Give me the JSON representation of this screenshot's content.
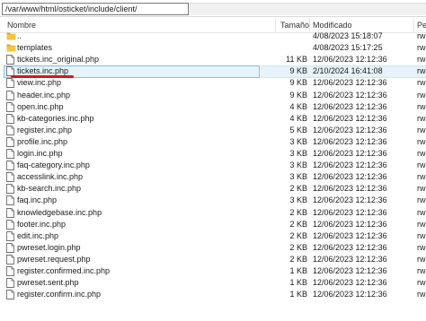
{
  "path": "/var/www/html/osticket/include/client/",
  "columns": {
    "name": "Nombre",
    "size": "Tamaño",
    "modified": "Modificado",
    "perm": "Pe"
  },
  "rows": [
    {
      "icon": "folder-icon",
      "name": "..",
      "size": "",
      "date": "4/08/2023 15:18:07",
      "perm": "rw"
    },
    {
      "icon": "folder-icon",
      "name": "templates",
      "size": "",
      "date": "4/08/2023 15:17:25",
      "perm": "rw"
    },
    {
      "icon": "file-icon",
      "name": "tickets.inc_original.php",
      "size": "11 KB",
      "date": "12/06/2023 12:12:36",
      "perm": "rw"
    },
    {
      "icon": "file-icon",
      "name": "tickets.inc.php",
      "size": "9 KB",
      "date": "2/10/2024 16:41:08",
      "perm": "rw"
    },
    {
      "icon": "file-icon",
      "name": "view.inc.php",
      "size": "9 KB",
      "date": "12/06/2023 12:12:36",
      "perm": "rw"
    },
    {
      "icon": "file-icon",
      "name": "header.inc.php",
      "size": "9 KB",
      "date": "12/06/2023 12:12:36",
      "perm": "rw"
    },
    {
      "icon": "file-icon",
      "name": "open.inc.php",
      "size": "4 KB",
      "date": "12/06/2023 12:12:36",
      "perm": "rw"
    },
    {
      "icon": "file-icon",
      "name": "kb-categories.inc.php",
      "size": "4 KB",
      "date": "12/06/2023 12:12:36",
      "perm": "rw"
    },
    {
      "icon": "file-icon",
      "name": "register.inc.php",
      "size": "5 KB",
      "date": "12/06/2023 12:12:36",
      "perm": "rw"
    },
    {
      "icon": "file-icon",
      "name": "profile.inc.php",
      "size": "3 KB",
      "date": "12/06/2023 12:12:36",
      "perm": "rw"
    },
    {
      "icon": "file-icon",
      "name": "login.inc.php",
      "size": "3 KB",
      "date": "12/06/2023 12:12:36",
      "perm": "rw"
    },
    {
      "icon": "file-icon",
      "name": "faq-category.inc.php",
      "size": "3 KB",
      "date": "12/06/2023 12:12:36",
      "perm": "rw"
    },
    {
      "icon": "file-icon",
      "name": "accesslink.inc.php",
      "size": "3 KB",
      "date": "12/06/2023 12:12:36",
      "perm": "rw"
    },
    {
      "icon": "file-icon",
      "name": "kb-search.inc.php",
      "size": "2 KB",
      "date": "12/06/2023 12:12:36",
      "perm": "rw"
    },
    {
      "icon": "file-icon",
      "name": "faq.inc.php",
      "size": "3 KB",
      "date": "12/06/2023 12:12:36",
      "perm": "rw"
    },
    {
      "icon": "file-icon",
      "name": "knowledgebase.inc.php",
      "size": "2 KB",
      "date": "12/06/2023 12:12:36",
      "perm": "rw"
    },
    {
      "icon": "file-icon",
      "name": "footer.inc.php",
      "size": "2 KB",
      "date": "12/06/2023 12:12:36",
      "perm": "rw"
    },
    {
      "icon": "file-icon",
      "name": "edit.inc.php",
      "size": "2 KB",
      "date": "12/06/2023 12:12:36",
      "perm": "rw"
    },
    {
      "icon": "file-icon",
      "name": "pwreset.login.php",
      "size": "2 KB",
      "date": "12/06/2023 12:12:36",
      "perm": "rw"
    },
    {
      "icon": "file-icon",
      "name": "pwreset.request.php",
      "size": "2 KB",
      "date": "12/06/2023 12:12:36",
      "perm": "rw"
    },
    {
      "icon": "file-icon",
      "name": "register.confirmed.inc.php",
      "size": "1 KB",
      "date": "12/06/2023 12:12:36",
      "perm": "rw"
    },
    {
      "icon": "file-icon",
      "name": "pwreset.sent.php",
      "size": "1 KB",
      "date": "12/06/2023 12:12:36",
      "perm": "rw"
    },
    {
      "icon": "file-icon",
      "name": "register.confirm.inc.php",
      "size": "1 KB",
      "date": "12/06/2023 12:12:36",
      "perm": "rw"
    }
  ],
  "selected_row": "tickets.inc.php",
  "colors": {
    "selection": "#e6f3fb",
    "selection_border": "#7fbfe8",
    "annotation": "#e0131a"
  }
}
